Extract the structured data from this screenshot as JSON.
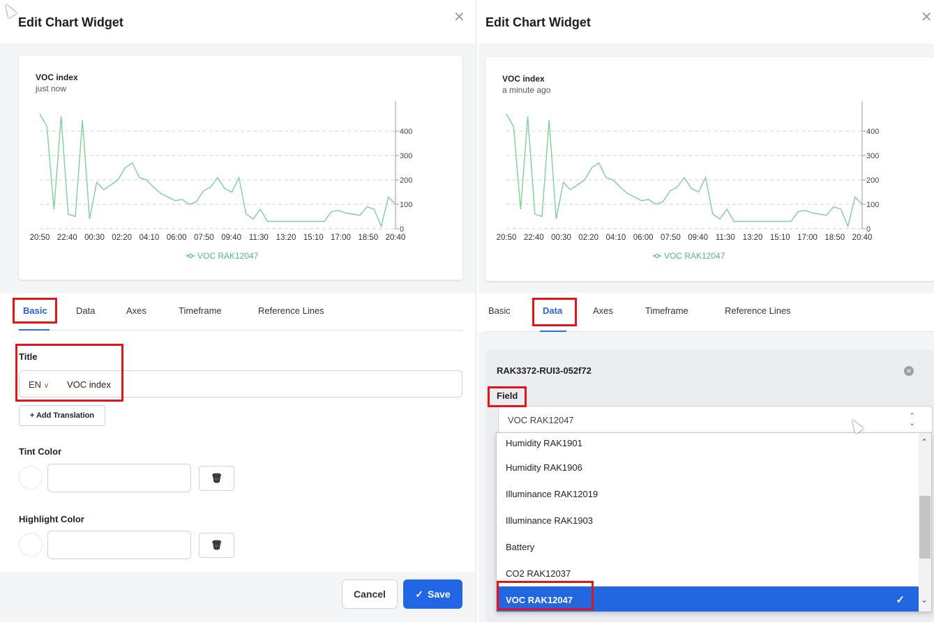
{
  "dialog_title": "Edit Chart Widget",
  "left": {
    "chart": {
      "title": "VOC index",
      "subtitle": "just now",
      "legend": "VOC RAK12047"
    },
    "tabs": [
      "Basic",
      "Data",
      "Axes",
      "Timeframe",
      "Reference Lines"
    ],
    "active_tab": "Basic",
    "title_label": "Title",
    "lang": "EN",
    "title_value": "VOC index",
    "add_translation": "+ Add Translation",
    "tint_label": "Tint Color",
    "highlight_label": "Highlight Color",
    "cancel": "Cancel",
    "save": "Save"
  },
  "right": {
    "chart": {
      "title": "VOC index",
      "subtitle": "a minute ago",
      "legend": "VOC RAK12047"
    },
    "tabs": [
      "Basic",
      "Data",
      "Axes",
      "Timeframe",
      "Reference Lines"
    ],
    "active_tab": "Data",
    "device": "RAK3372-RUI3-052f72",
    "field_label": "Field",
    "field_value": "VOC RAK12047",
    "options": [
      "Humidity RAK1901",
      "Humidity RAK1906",
      "Illuminance RAK12019",
      "Illuminance RAK1903",
      "Battery",
      "CO2 RAK12037",
      "VOC RAK12047"
    ],
    "selected_option": "VOC RAK12047"
  },
  "colors": {
    "accent": "#2066e5",
    "series": "#7fcf9a",
    "highlight": "#e0161b"
  },
  "chart_data": [
    {
      "type": "line",
      "title": "VOC index",
      "x": [
        "20:50",
        "22:40",
        "00:30",
        "02:20",
        "04:10",
        "06:00",
        "07:50",
        "09:40",
        "11:30",
        "13:20",
        "15:10",
        "17:00",
        "18:50",
        "20:40"
      ],
      "y_ticks": [
        0,
        100,
        200,
        300,
        400
      ],
      "ylim": [
        0,
        480
      ],
      "grid": true,
      "series": [
        {
          "name": "VOC RAK12047",
          "color": "#7fcf9a",
          "values": [
            470,
            420,
            80,
            460,
            60,
            50,
            445,
            40,
            190,
            160,
            180,
            200,
            250,
            270,
            210,
            200,
            170,
            145,
            130,
            115,
            120,
            100,
            110,
            155,
            170,
            210,
            165,
            150,
            210,
            60,
            40,
            80,
            30,
            30,
            30,
            30,
            30,
            30,
            30,
            30,
            30,
            70,
            75,
            65,
            60,
            55,
            90,
            80,
            10,
            130,
            100
          ]
        }
      ]
    },
    {
      "type": "line",
      "title": "VOC index",
      "x": [
        "20:50",
        "22:40",
        "00:30",
        "02:20",
        "04:10",
        "06:00",
        "07:50",
        "09:40",
        "11:30",
        "13:20",
        "15:10",
        "17:00",
        "18:50",
        "20:40"
      ],
      "y_ticks": [
        0,
        100,
        200,
        300,
        400
      ],
      "ylim": [
        0,
        480
      ],
      "grid": true,
      "series": [
        {
          "name": "VOC RAK12047",
          "color": "#7fcf9a",
          "values": [
            470,
            420,
            80,
            460,
            60,
            50,
            445,
            40,
            190,
            160,
            180,
            200,
            250,
            270,
            210,
            200,
            170,
            145,
            130,
            115,
            120,
            100,
            110,
            155,
            170,
            210,
            165,
            150,
            210,
            60,
            40,
            80,
            30,
            30,
            30,
            30,
            30,
            30,
            30,
            30,
            30,
            70,
            75,
            65,
            60,
            55,
            90,
            80,
            10,
            130,
            100
          ]
        }
      ]
    }
  ]
}
